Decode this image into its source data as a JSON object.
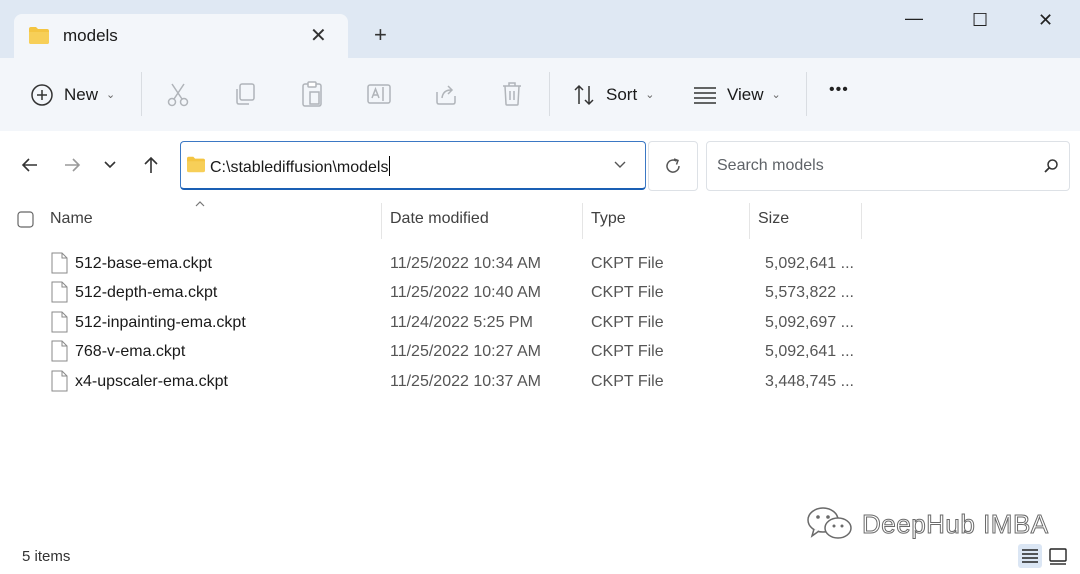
{
  "window": {
    "tab_title": "models",
    "tab_close_glyph": "✕",
    "new_tab_glyph": "+",
    "controls": {
      "minimize": "—",
      "maximize": "☐",
      "close": "✕"
    }
  },
  "toolbar": {
    "new_label": "New",
    "sort_label": "Sort",
    "view_label": "View",
    "more_glyph": "•••",
    "chevron_glyph": "⌄",
    "icons": [
      "cut-icon",
      "copy-icon",
      "paste-icon",
      "rename-icon",
      "share-icon",
      "delete-icon"
    ]
  },
  "navigation": {
    "address_path": "C:\\stablediffusion\\models",
    "search_placeholder": "Search models"
  },
  "file_list": {
    "columns": {
      "name": "Name",
      "date": "Date modified",
      "type": "Type",
      "size": "Size"
    },
    "rows": [
      {
        "name": "512-base-ema.ckpt",
        "date": "11/25/2022 10:34 AM",
        "type": "CKPT File",
        "size": "5,092,641 ..."
      },
      {
        "name": "512-depth-ema.ckpt",
        "date": "11/25/2022 10:40 AM",
        "type": "CKPT File",
        "size": "5,573,822 ..."
      },
      {
        "name": "512-inpainting-ema.ckpt",
        "date": "11/24/2022 5:25 PM",
        "type": "CKPT File",
        "size": "5,092,697 ..."
      },
      {
        "name": "768-v-ema.ckpt",
        "date": "11/25/2022 10:27 AM",
        "type": "CKPT File",
        "size": "5,092,641 ..."
      },
      {
        "name": "x4-upscaler-ema.ckpt",
        "date": "11/25/2022 10:37 AM",
        "type": "CKPT File",
        "size": "3,448,745 ..."
      }
    ]
  },
  "status": {
    "item_count": "5 items"
  },
  "watermark": {
    "text": "DeepHub IMBA"
  },
  "colors": {
    "accent": "#1a5fb4",
    "titlebar": "#dfe8f3",
    "toolbar": "#f3f6fa",
    "folder": "#f4c542"
  }
}
